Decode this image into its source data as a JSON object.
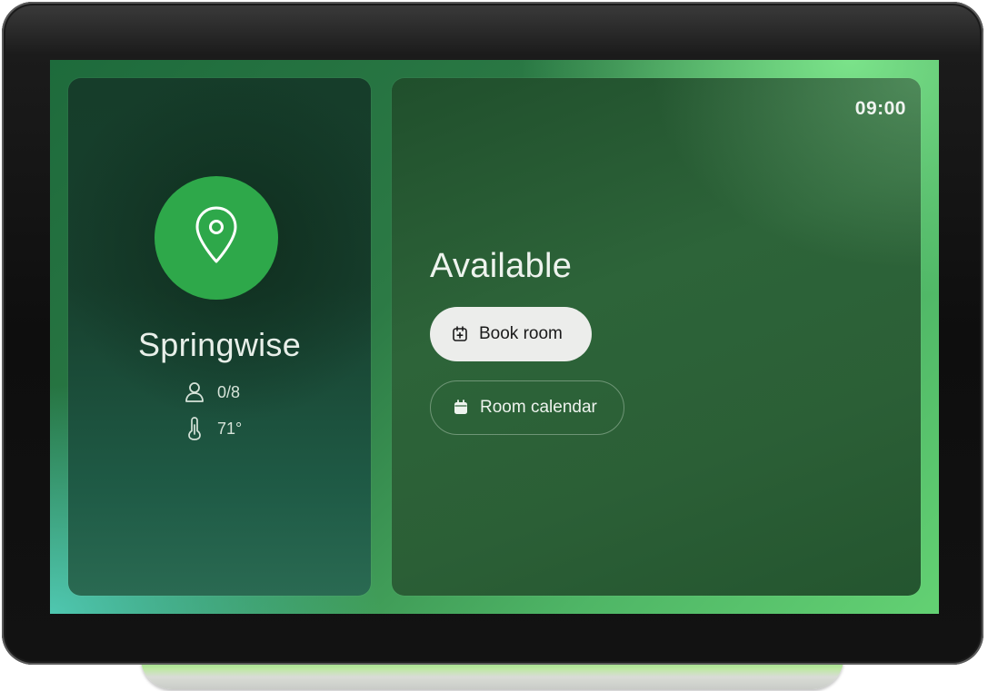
{
  "clock": "09:00",
  "room": {
    "name": "Springwise",
    "capacity": "0/8",
    "temperature": "71°"
  },
  "status": "Available",
  "actions": {
    "book_label": "Book room",
    "calendar_label": "Room calendar"
  },
  "colors": {
    "accent": "#2ea84a",
    "light_bar": "#63d173",
    "button_bg": "#ecedeb"
  },
  "icons": [
    "location-pin-icon",
    "person-icon",
    "thermometer-icon",
    "calendar-plus-icon",
    "calendar-icon"
  ]
}
